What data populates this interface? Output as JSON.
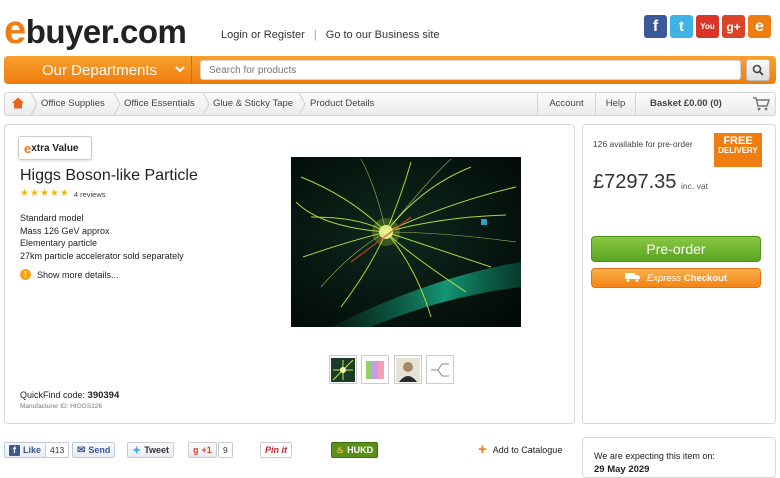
{
  "header": {
    "logo_e": "e",
    "logo_rest": "buyer.com",
    "login": "Login or Register",
    "separator": "|",
    "business": "Go to our Business site",
    "social": [
      {
        "name": "facebook-icon",
        "glyph": "f",
        "color": "#3b5998"
      },
      {
        "name": "twitter-icon",
        "glyph": "t",
        "color": "#3fb3e6"
      },
      {
        "name": "youtube-icon",
        "glyph": "You",
        "color": "#d9352b"
      },
      {
        "name": "google-plus-icon",
        "glyph": "g+",
        "color": "#d9452b"
      },
      {
        "name": "ebuyer-icon",
        "glyph": "e",
        "color": "#f07d12"
      }
    ]
  },
  "nav": {
    "departments": "Our Departments",
    "search_placeholder": "Search for products"
  },
  "breadcrumb": {
    "items": [
      "Office Supplies",
      "Office Essentials",
      "Glue & Sticky Tape",
      "Product Details"
    ],
    "account": "Account",
    "help": "Help",
    "basket": "Basket £0.00 (0)"
  },
  "product": {
    "badge_prefix": "e",
    "badge_text": "xtra Value",
    "title": "Higgs Boson-like Particle",
    "rating_stars": 5,
    "reviews": "4 reviews",
    "specs": [
      "Standard model",
      "Mass 126 GeV approx",
      "Elementary particle",
      "27km particle accelerator sold separately"
    ],
    "more_details": "Show more details...",
    "quickfind_label": "QuickFind code:",
    "quickfind_code": "390394",
    "manufacturer_id": "Manufacturer ID: HIGGS126"
  },
  "purchase": {
    "availability": "126 available for pre-order",
    "free_line1": "FREE",
    "free_line2": "DELIVERY",
    "price": "£7297.35",
    "inc_vat": "inc. vat",
    "preorder": "Pre-order",
    "express_italic": "Express",
    "express_bold": "Checkout"
  },
  "share": {
    "like": "Like",
    "like_count": "413",
    "send": "Send",
    "tweet": "Tweet",
    "gplus": "+1",
    "gplus_count": "9",
    "pinit": "Pin it",
    "hukd": "HUKD",
    "add_catalogue": "Add to Catalogue"
  },
  "expected": {
    "label": "We are expecting this item on:",
    "date": "29 May 2029"
  },
  "colors": {
    "accent": "#f07d12",
    "green": "#6bb52c"
  }
}
